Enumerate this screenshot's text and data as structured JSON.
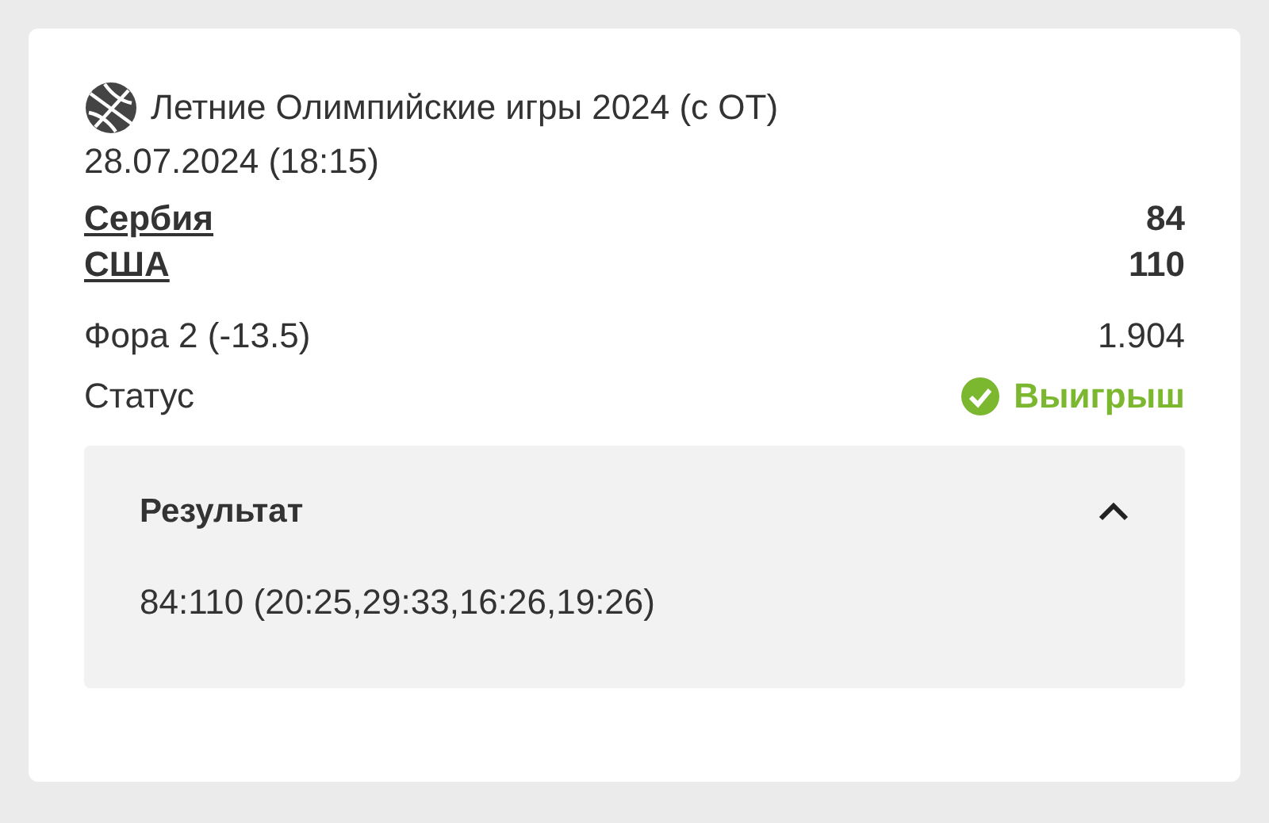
{
  "event": {
    "title": "Летние Олимпийские игры 2024 (с ОТ)",
    "date": "28.07.2024 (18:15)"
  },
  "teams": [
    {
      "name": "Сербия",
      "score": "84"
    },
    {
      "name": "США",
      "score": "110"
    }
  ],
  "bet": {
    "label": "Фора 2 (-13.5)",
    "odds": "1.904"
  },
  "status": {
    "label": "Статус",
    "value": "Выигрыш",
    "kind": "win"
  },
  "result": {
    "title": "Результат",
    "expanded": true,
    "text": "84:110 (20:25,29:33,16:26,19:26)"
  }
}
